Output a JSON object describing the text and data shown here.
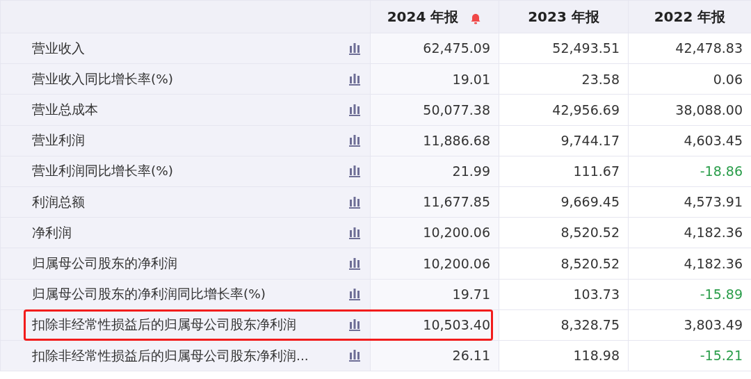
{
  "table": {
    "columns": [
      {
        "label": "2024 年报",
        "alert": true
      },
      {
        "label": "2023 年报",
        "alert": false
      },
      {
        "label": "2022 年报",
        "alert": false
      }
    ],
    "rows": [
      {
        "label": "营业收入",
        "highlighted": false,
        "cells": [
          {
            "text": "62,475.09",
            "down": false
          },
          {
            "text": "52,493.51",
            "down": false
          },
          {
            "text": "42,478.83",
            "down": false
          }
        ]
      },
      {
        "label": "营业收入同比增长率(%)",
        "highlighted": false,
        "cells": [
          {
            "text": "19.01",
            "down": false
          },
          {
            "text": "23.58",
            "down": false
          },
          {
            "text": "0.06",
            "down": false
          }
        ]
      },
      {
        "label": "营业总成本",
        "highlighted": false,
        "cells": [
          {
            "text": "50,077.38",
            "down": false
          },
          {
            "text": "42,956.69",
            "down": false
          },
          {
            "text": "38,088.00",
            "down": false
          }
        ]
      },
      {
        "label": "营业利润",
        "highlighted": false,
        "cells": [
          {
            "text": "11,886.68",
            "down": false
          },
          {
            "text": "9,744.17",
            "down": false
          },
          {
            "text": "4,603.45",
            "down": false
          }
        ]
      },
      {
        "label": "营业利润同比增长率(%)",
        "highlighted": false,
        "cells": [
          {
            "text": "21.99",
            "down": false
          },
          {
            "text": "111.67",
            "down": false
          },
          {
            "text": "-18.86",
            "down": true
          }
        ]
      },
      {
        "label": "利润总额",
        "highlighted": false,
        "cells": [
          {
            "text": "11,677.85",
            "down": false
          },
          {
            "text": "9,669.45",
            "down": false
          },
          {
            "text": "4,573.91",
            "down": false
          }
        ]
      },
      {
        "label": "净利润",
        "highlighted": false,
        "cells": [
          {
            "text": "10,200.06",
            "down": false
          },
          {
            "text": "8,520.52",
            "down": false
          },
          {
            "text": "4,182.36",
            "down": false
          }
        ]
      },
      {
        "label": "归属母公司股东的净利润",
        "highlighted": false,
        "cells": [
          {
            "text": "10,200.06",
            "down": false
          },
          {
            "text": "8,520.52",
            "down": false
          },
          {
            "text": "4,182.36",
            "down": false
          }
        ]
      },
      {
        "label": "归属母公司股东的净利润同比增长率(%)",
        "highlighted": false,
        "cells": [
          {
            "text": "19.71",
            "down": false
          },
          {
            "text": "103.73",
            "down": false
          },
          {
            "text": "-15.89",
            "down": true
          }
        ]
      },
      {
        "label": "扣除非经常性损益后的归属母公司股东净利润",
        "highlighted": true,
        "cells": [
          {
            "text": "10,503.40",
            "down": false
          },
          {
            "text": "8,328.75",
            "down": false
          },
          {
            "text": "3,803.49",
            "down": false
          }
        ]
      },
      {
        "label": "扣除非经常性损益后的归属母公司股东净利润...",
        "highlighted": false,
        "cells": [
          {
            "text": "26.11",
            "down": false
          },
          {
            "text": "118.98",
            "down": false
          },
          {
            "text": "-15.21",
            "down": true
          }
        ]
      }
    ]
  }
}
